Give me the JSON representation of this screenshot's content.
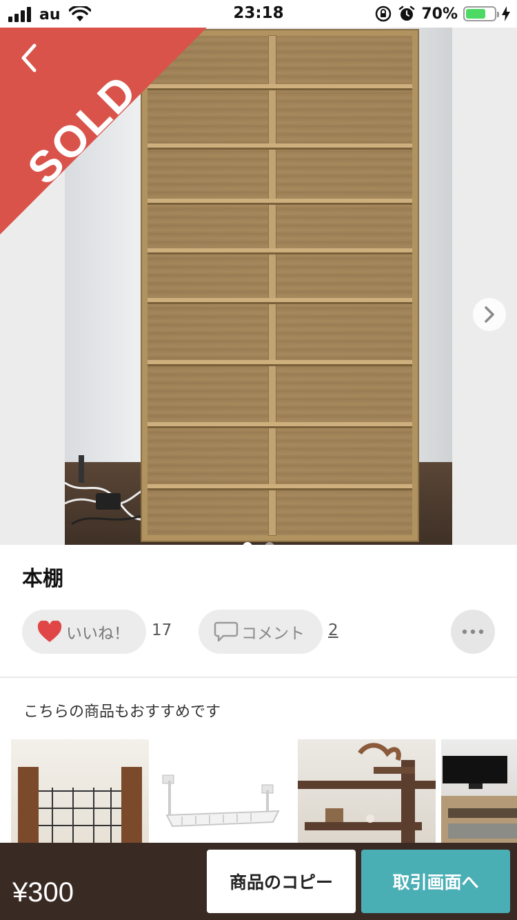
{
  "status_bar": {
    "carrier": "au",
    "time": "23:18",
    "battery_percent": "70%",
    "battery_level": 0.7,
    "icons": [
      "signal-icon",
      "wifi-icon",
      "rotation-lock-icon",
      "alarm-icon",
      "battery-icon",
      "charging-icon"
    ]
  },
  "product_images": {
    "sold_label": "SOLD",
    "image_count": 2,
    "current_index": 0
  },
  "product": {
    "title": "本棚",
    "price": "¥300"
  },
  "actions": {
    "like_label": "いいね！",
    "like_count": "17",
    "comment_label": "コメント",
    "comment_count": "2"
  },
  "recommendations": {
    "heading": "こちらの商品もおすすめです",
    "items": [
      "rack",
      "hanging-shelf",
      "wooden-shelf",
      "tv-stand"
    ]
  },
  "bottom_bar": {
    "copy_label": "商品のコピー",
    "trade_label": "取引画面へ"
  },
  "colors": {
    "sold_banner": "#d9534a",
    "bottom_bar": "#3a2a24",
    "trade_button": "#4aaeb5",
    "like_heart": "#e04646"
  }
}
